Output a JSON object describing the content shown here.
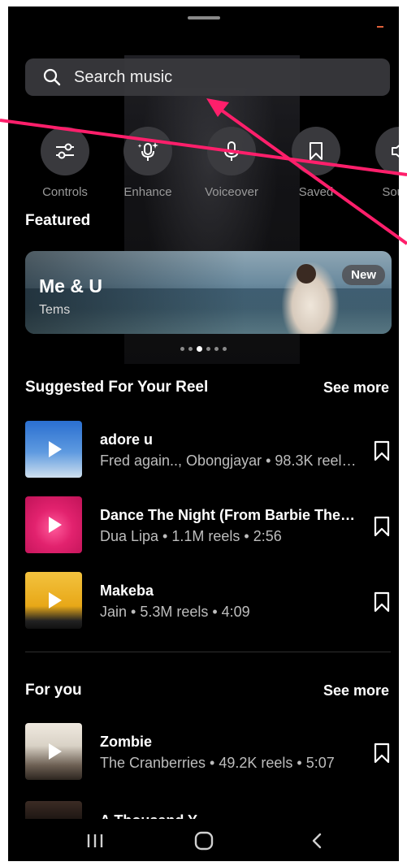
{
  "search": {
    "placeholder": "Search music"
  },
  "tools": [
    {
      "label": "Controls",
      "icon": "sliders-icon"
    },
    {
      "label": "Enhance",
      "icon": "sparkle-mic-icon"
    },
    {
      "label": "Voiceover",
      "icon": "microphone-icon"
    },
    {
      "label": "Saved",
      "icon": "bookmark-icon"
    },
    {
      "label": "Sound",
      "icon": "speaker-icon"
    }
  ],
  "featured": {
    "title": "Featured",
    "card": {
      "song": "Me & U",
      "artist": "Tems",
      "badge": "New"
    },
    "pagination": {
      "count": 6,
      "active_index": 2
    }
  },
  "suggested": {
    "title": "Suggested For Your Reel",
    "see_more": "See more",
    "tracks": [
      {
        "name": "adore u",
        "meta": "Fred again.., Obongjayar • 98.3K reel…",
        "cover_color": "#3d77c4"
      },
      {
        "name": "Dance The Night (From Barbie The…",
        "meta": "Dua Lipa • 1.1M reels • 2:56",
        "cover_color": "#e2226e"
      },
      {
        "name": "Makeba",
        "meta": "Jain • 5.3M reels • 4:09",
        "cover_color": "#f0b830"
      }
    ]
  },
  "for_you": {
    "title": "For you",
    "see_more": "See more",
    "tracks": [
      {
        "name": "Zombie",
        "meta": "The Cranberries • 49.2K reels • 5:07",
        "cover_color": "#e9e4da"
      }
    ],
    "partial_track": {
      "name": "A Thousand Y…"
    }
  },
  "nav": {
    "recents": "recents-icon",
    "home": "home-icon",
    "back": "back-icon"
  },
  "colors": {
    "annotation_arrow": "#ff1f6b",
    "background": "#000000",
    "surface": "#3a3a3e"
  }
}
